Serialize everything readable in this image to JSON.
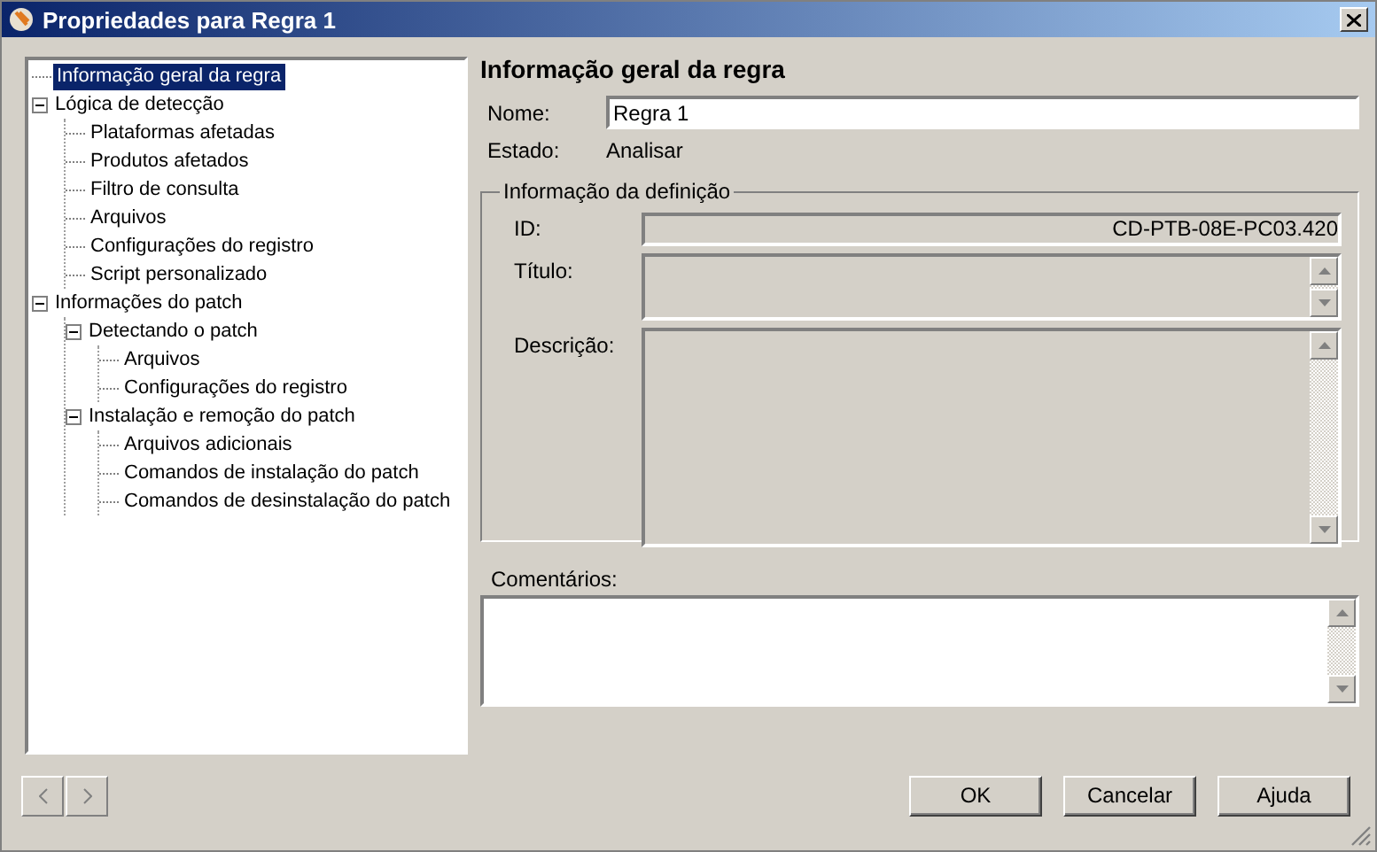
{
  "window": {
    "title": "Propriedades para Regra 1"
  },
  "tree": [
    {
      "label": "Informação geral da regra",
      "selected": true
    },
    {
      "label": "Lógica de detecção",
      "selected": false,
      "expanded": true,
      "children": [
        {
          "label": "Plataformas afetadas",
          "selected": false
        },
        {
          "label": "Produtos afetados",
          "selected": false
        },
        {
          "label": "Filtro de consulta",
          "selected": false
        },
        {
          "label": "Arquivos",
          "selected": false
        },
        {
          "label": "Configurações do registro",
          "selected": false
        },
        {
          "label": "Script personalizado",
          "selected": false
        }
      ]
    },
    {
      "label": "Informações do patch",
      "selected": false,
      "expanded": true,
      "children": [
        {
          "label": "Detectando o patch",
          "selected": false,
          "expanded": true,
          "children": [
            {
              "label": "Arquivos",
              "selected": false
            },
            {
              "label": "Configurações do registro",
              "selected": false
            }
          ]
        },
        {
          "label": "Instalação e remoção do patch",
          "selected": false,
          "expanded": true,
          "children": [
            {
              "label": "Arquivos adicionais",
              "selected": false
            },
            {
              "label": "Comandos de instalação do patch",
              "selected": false
            },
            {
              "label": "Comandos de desinstalação do patch",
              "selected": false
            }
          ]
        }
      ]
    }
  ],
  "panel": {
    "heading": "Informação geral da regra",
    "name_label": "Nome:",
    "name_value": "Regra 1",
    "state_label": "Estado:",
    "state_value": "Analisar",
    "group": {
      "legend": "Informação da definição",
      "id_label": "ID:",
      "id_value": "CD-PTB-08E-PC03.420",
      "title_label": "Título:",
      "description_label": "Descrição:"
    },
    "comments_label": "Comentários:"
  },
  "buttons": [
    "OK",
    "Cancelar",
    "Ajuda"
  ]
}
